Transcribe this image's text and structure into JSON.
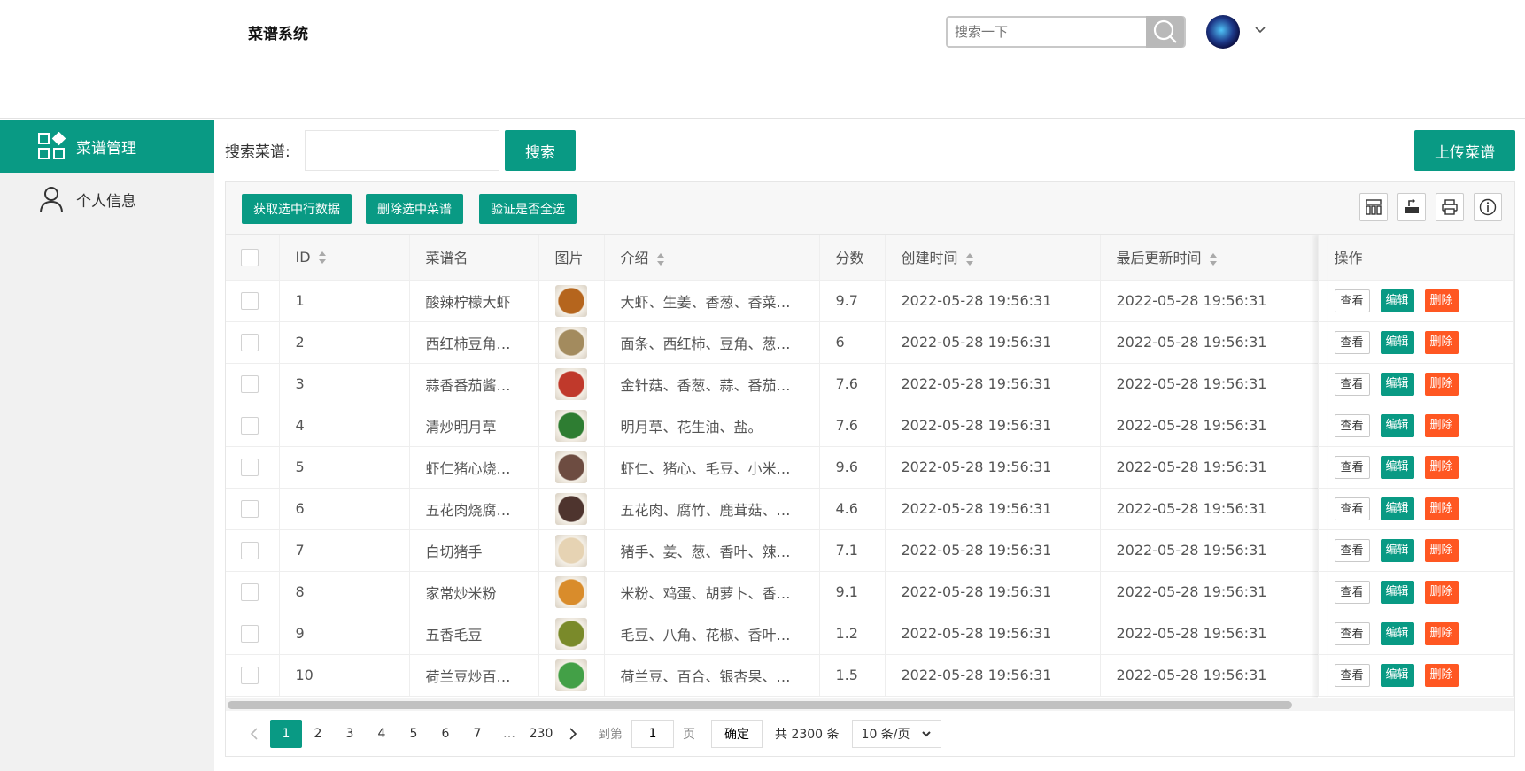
{
  "header": {
    "title": "菜谱系统",
    "search_placeholder": "搜索一下"
  },
  "sidebar": {
    "items": [
      {
        "label": "菜谱管理",
        "icon": "grid-icon",
        "active": true
      },
      {
        "label": "个人信息",
        "icon": "user-icon",
        "active": false
      }
    ]
  },
  "search": {
    "label": "搜索菜谱:",
    "button": "搜索",
    "upload": "上传菜谱"
  },
  "toolbar": {
    "get_selected": "获取选中行数据",
    "delete_selected": "删除选中菜谱",
    "check_all": "验证是否全选"
  },
  "table": {
    "headers": [
      "ID",
      "菜谱名",
      "图片",
      "介绍",
      "分数",
      "创建时间",
      "最后更新时间",
      "操作"
    ],
    "actions": {
      "view": "查看",
      "edit": "编辑",
      "delete": "删除"
    },
    "rows": [
      {
        "id": "1",
        "name": "酸辣柠檬大虾",
        "intro": "大虾、生姜、香葱、香菜…",
        "score": "9.7",
        "created": "2022-05-28 19:56:31",
        "updated": "2022-05-28 19:56:31",
        "color": "#b5651d"
      },
      {
        "id": "2",
        "name": "西红柿豆角…",
        "intro": "面条、西红柿、豆角、葱…",
        "score": "6",
        "created": "2022-05-28 19:56:31",
        "updated": "2022-05-28 19:56:31",
        "color": "#a38b5e"
      },
      {
        "id": "3",
        "name": "蒜香番茄酱…",
        "intro": "金针菇、香葱、蒜、番茄…",
        "score": "7.6",
        "created": "2022-05-28 19:56:31",
        "updated": "2022-05-28 19:56:31",
        "color": "#c0392b"
      },
      {
        "id": "4",
        "name": "清炒明月草",
        "intro": "明月草、花生油、盐。",
        "score": "7.6",
        "created": "2022-05-28 19:56:31",
        "updated": "2022-05-28 19:56:31",
        "color": "#2e7d32"
      },
      {
        "id": "5",
        "name": "虾仁猪心烧…",
        "intro": "虾仁、猪心、毛豆、小米…",
        "score": "9.6",
        "created": "2022-05-28 19:56:31",
        "updated": "2022-05-28 19:56:31",
        "color": "#6d4c41"
      },
      {
        "id": "6",
        "name": "五花肉烧腐…",
        "intro": "五花肉、腐竹、鹿茸菇、…",
        "score": "4.6",
        "created": "2022-05-28 19:56:31",
        "updated": "2022-05-28 19:56:31",
        "color": "#4e342e"
      },
      {
        "id": "7",
        "name": "白切猪手",
        "intro": "猪手、姜、葱、香叶、辣…",
        "score": "7.1",
        "created": "2022-05-28 19:56:31",
        "updated": "2022-05-28 19:56:31",
        "color": "#e6d3b3"
      },
      {
        "id": "8",
        "name": "家常炒米粉",
        "intro": "米粉、鸡蛋、胡萝卜、香…",
        "score": "9.1",
        "created": "2022-05-28 19:56:31",
        "updated": "2022-05-28 19:56:31",
        "color": "#d98c2b"
      },
      {
        "id": "9",
        "name": "五香毛豆",
        "intro": "毛豆、八角、花椒、香叶…",
        "score": "1.2",
        "created": "2022-05-28 19:56:31",
        "updated": "2022-05-28 19:56:31",
        "color": "#7a8a2a"
      },
      {
        "id": "10",
        "name": "荷兰豆炒百…",
        "intro": "荷兰豆、百合、银杏果、…",
        "score": "1.5",
        "created": "2022-05-28 19:56:31",
        "updated": "2022-05-28 19:56:31",
        "color": "#43a047"
      }
    ]
  },
  "pager": {
    "pages": [
      "1",
      "2",
      "3",
      "4",
      "5",
      "6",
      "7"
    ],
    "ellipsis": "…",
    "last": "230",
    "goto_label": "到第",
    "goto_value": "1",
    "page_unit": "页",
    "confirm": "确定",
    "total": "共 2300 条",
    "limit": "10 条/页"
  },
  "colors": {
    "accent": "#099a84",
    "danger": "#ff5722"
  }
}
